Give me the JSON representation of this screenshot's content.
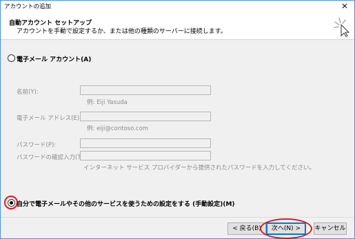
{
  "window": {
    "title": "アカウントの追加",
    "close_glyph": "✕"
  },
  "header": {
    "title": "自動アカウント セットアップ",
    "description": "アカウントを手動で設定するか、または他の種類のサーバーに接続します。"
  },
  "options": {
    "email_account_label": "電子メール アカウント(A)",
    "manual_setup_label": "自分で電子メールやその他のサービスを使うための設定をする (手動設定)(M)",
    "selected": "manual_setup"
  },
  "form": {
    "name_label": "名前(Y):",
    "name_example": "例: Eiji Yasuda",
    "email_label": "電子メール アドレス(E):",
    "email_example": "例: eiji@contoso.com",
    "password_label": "パスワード(P):",
    "password_confirm_label": "パスワードの確認入力(T):",
    "password_hint": "インターネット サービス プロバイダーから提供されたパスワードを入力してください。"
  },
  "buttons": {
    "back": "< 戻る(B)",
    "next": "次へ(N) >",
    "cancel": "キャンセル"
  },
  "colors": {
    "annotation_circle": "#e0181b",
    "window_border": "#4a90d9",
    "default_button_border": "#0078d7"
  }
}
